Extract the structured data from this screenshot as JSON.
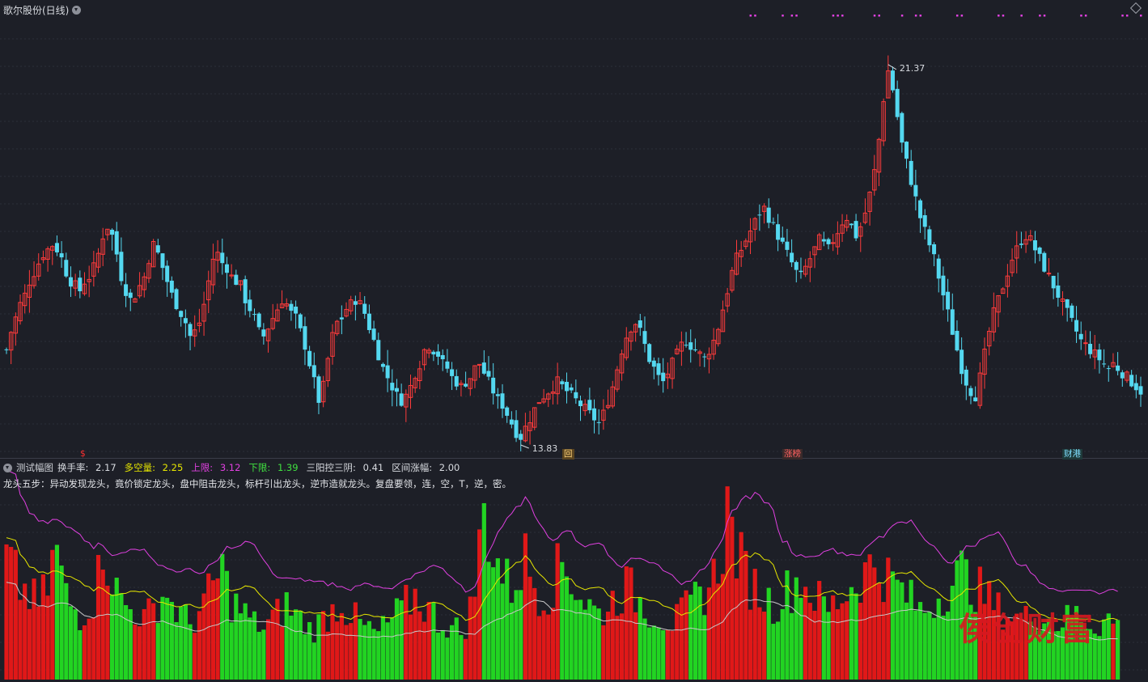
{
  "header": {
    "title": "歌尔股份(日线)"
  },
  "price_panel": {
    "high_label": "21.37",
    "low_label": "13.83"
  },
  "markers": [
    {
      "text": "$",
      "color": "#ff3030",
      "bg": "transparent"
    },
    {
      "text": "回",
      "color": "#ffd37a",
      "bg": "#5a4420"
    },
    {
      "text": "涨榜",
      "color": "#ff6060",
      "bg": "#3a2a2a"
    },
    {
      "text": "财港",
      "color": "#7fdfff",
      "bg": "#1f3a3a"
    }
  ],
  "indicator": {
    "name": "测试幅图",
    "turnover_label": "换手率:",
    "turnover_value": "2.17",
    "longshort_label": "多空量:",
    "longshort_value": "2.25",
    "upper_label": "上限:",
    "upper_value": "3.12",
    "lower_label": "下限:",
    "lower_value": "1.39",
    "three_label": "三阳控三阴:",
    "three_value": "0.41",
    "range_label": "区间涨幅:",
    "range_value": "2.00",
    "description": "龙头五步：异动发现龙头，竟价锁定龙头，盘中阻击龙头，标杆引出龙头，逆市造就龙头。复盘要领，连，空，T，逆，密。",
    "colors": {
      "turnover": "#d8dbe0",
      "longshort": "#e6e600",
      "upper": "#e040e0",
      "lower": "#40e040",
      "three": "#d8dbe0",
      "range": "#d8dbe0"
    }
  },
  "watermark": "侯创财富",
  "colors": {
    "background": "#1d1f27",
    "up": "#ff3b3b",
    "down": "#54d8f0",
    "vol_up": "#e01818",
    "vol_down": "#22d422",
    "ma_yellow": "#e6e600",
    "ma_magenta": "#e040e0",
    "signal_dots": "#e040e0"
  },
  "chart_data": {
    "type": "candlestick",
    "ylim": [
      13.0,
      22.2
    ],
    "price_path": [
      14.9,
      15.3,
      15.6,
      15.9,
      16.1,
      16.4,
      16.6,
      16.8,
      17.0,
      17.1,
      17.2,
      17.1,
      16.9,
      16.6,
      16.4,
      16.3,
      16.2,
      16.4,
      16.5,
      16.7,
      17.0,
      17.4,
      17.6,
      17.4,
      17.0,
      16.5,
      16.2,
      16.0,
      16.1,
      16.3,
      16.5,
      16.9,
      17.2,
      17.0,
      16.7,
      16.4,
      16.1,
      15.9,
      15.7,
      15.5,
      15.2,
      15.3,
      15.5,
      15.9,
      16.4,
      16.9,
      17.0,
      16.8,
      16.7,
      16.5,
      16.4,
      16.3,
      16.0,
      15.8,
      15.6,
      15.3,
      15.2,
      15.4,
      15.6,
      15.8,
      16.0,
      15.9,
      15.7,
      15.6,
      15.3,
      15.0,
      14.6,
      14.2,
      13.8,
      14.1,
      14.7,
      15.2,
      15.5,
      15.6,
      15.8,
      15.9,
      16.0,
      15.9,
      15.7,
      15.4,
      15.1,
      14.8,
      14.5,
      14.3,
      14.1,
      13.9,
      13.8,
      13.9,
      14.1,
      14.4,
      14.6,
      14.9,
      15.0,
      14.9,
      14.8,
      14.6,
      14.5,
      14.3,
      14.2,
      14.1,
      14.2,
      14.3,
      14.5,
      14.6,
      14.4,
      14.2,
      14.0,
      13.8,
      13.7,
      13.5,
      13.3,
      13.1,
      13.0,
      13.2,
      13.4,
      13.6,
      13.8,
      13.9,
      14.0,
      14.1,
      14.2,
      14.1,
      14.0,
      13.9,
      13.8,
      13.7,
      13.6,
      13.5,
      13.4,
      13.3,
      13.5,
      13.8,
      14.1,
      14.5,
      14.9,
      15.2,
      15.4,
      15.5,
      15.3,
      15.0,
      14.7,
      14.5,
      14.3,
      14.2,
      14.4,
      14.6,
      14.8,
      15.0,
      15.1,
      15.0,
      14.9,
      14.8,
      14.7,
      14.9,
      15.1,
      15.4,
      15.8,
      16.2,
      16.6,
      16.9,
      17.1,
      17.3,
      17.5,
      17.7,
      17.9,
      18.0,
      17.8,
      17.6,
      17.4,
      17.2,
      17.0,
      16.8,
      16.6,
      16.5,
      16.7,
      16.9,
      17.1,
      17.3,
      17.2,
      17.1,
      17.3,
      17.5,
      17.7,
      17.8,
      17.6,
      17.4,
      17.6,
      17.9,
      18.3,
      18.8,
      19.5,
      20.4,
      21.0,
      20.6,
      20.0,
      19.4,
      19.0,
      18.6,
      18.2,
      17.8,
      17.5,
      17.2,
      16.9,
      16.5,
      16.1,
      15.7,
      15.3,
      14.9,
      14.5,
      14.2,
      14.0,
      13.9,
      14.3,
      14.8,
      15.3,
      15.7,
      16.0,
      16.3,
      16.6,
      16.9,
      17.1,
      17.3,
      17.4,
      17.3,
      17.1,
      16.9,
      16.7,
      16.5,
      16.3,
      16.1,
      15.9,
      15.7,
      15.5,
      15.3,
      15.1,
      15.0,
      14.9,
      14.8,
      14.7,
      14.6,
      14.5,
      14.6,
      14.5,
      14.4,
      14.3,
      14.2,
      14.1,
      14.0
    ],
    "volume_path": [
      2.6,
      2.4,
      2.2,
      2.0,
      1.9,
      1.8,
      1.7,
      1.6,
      1.8,
      2.0,
      2.5,
      2.8,
      2.2,
      1.8,
      1.6,
      1.5,
      1.4,
      1.5,
      1.6,
      1.8,
      2.2,
      3.0,
      2.6,
      2.2,
      1.9,
      1.7,
      1.6,
      1.5,
      1.5,
      1.4,
      1.3,
      1.4,
      1.5,
      1.7,
      1.8,
      1.9,
      1.6,
      1.5,
      1.4,
      1.3,
      1.2,
      1.3,
      1.5,
      1.6,
      1.8,
      2.0,
      2.2,
      2.4,
      2.0,
      1.7,
      1.6,
      1.5,
      1.4,
      1.3,
      1.2,
      1.2,
      1.1,
      1.2,
      1.3,
      1.4,
      1.5,
      1.6,
      1.5,
      1.4,
      1.3,
      1.2,
      1.1,
      1.1,
      1.2,
      1.3,
      1.4,
      1.5,
      1.6,
      1.7,
      1.5,
      1.4,
      1.3,
      1.2,
      1.1,
      1.1,
      1.0,
      1.0,
      1.1,
      1.2,
      1.3,
      1.4,
      1.5,
      1.6,
      1.7,
      1.8,
      1.7,
      1.6,
      1.5,
      1.4,
      1.3,
      1.2,
      1.2,
      1.1,
      1.1,
      1.0,
      1.2,
      1.5,
      2.0,
      2.8,
      3.6,
      3.2,
      2.8,
      2.5,
      2.3,
      2.1,
      2.0,
      2.2,
      2.4,
      2.6,
      2.3,
      2.1,
      1.9,
      1.8,
      1.9,
      2.1,
      2.3,
      2.5,
      2.4,
      2.2,
      2.0,
      1.8,
      1.7,
      1.6,
      1.5,
      1.4,
      1.5,
      1.6,
      1.7,
      1.8,
      1.9,
      2.0,
      1.9,
      1.8,
      1.7,
      1.6,
      1.5,
      1.4,
      1.4,
      1.3,
      1.3,
      1.2,
      1.3,
      1.4,
      1.5,
      1.6,
      1.7,
      1.8,
      1.9,
      2.0,
      2.2,
      2.5,
      3.0,
      3.6,
      3.2,
      2.8,
      2.5,
      2.3,
      2.1,
      2.0,
      1.9,
      1.8,
      1.7,
      1.6,
      1.7,
      1.8,
      1.9,
      2.0,
      2.1,
      2.2,
      2.0,
      1.9,
      1.8,
      1.7,
      1.6,
      1.5,
      1.6,
      1.7,
      1.8,
      1.9,
      2.0,
      2.1,
      2.2,
      2.3,
      2.4,
      2.5,
      2.4,
      2.3,
      2.2,
      2.1,
      2.0,
      1.9,
      1.8,
      1.7,
      1.6,
      1.5,
      1.5,
      1.6,
      1.7,
      1.8,
      1.9,
      2.0,
      2.1,
      2.2,
      2.3,
      2.2,
      2.1,
      2.0,
      1.9,
      1.8,
      1.7,
      1.6,
      1.5,
      1.5,
      1.4,
      1.4,
      1.3,
      1.3,
      1.3,
      1.4,
      1.5,
      1.4,
      1.3,
      1.3,
      1.2,
      1.2,
      1.3,
      1.3,
      1.4,
      1.4,
      1.3,
      1.3,
      1.2,
      1.2,
      1.2,
      1.3,
      1.3,
      1.2,
      1.2
    ],
    "marker_days": [
      17,
      115,
      165,
      217
    ]
  }
}
